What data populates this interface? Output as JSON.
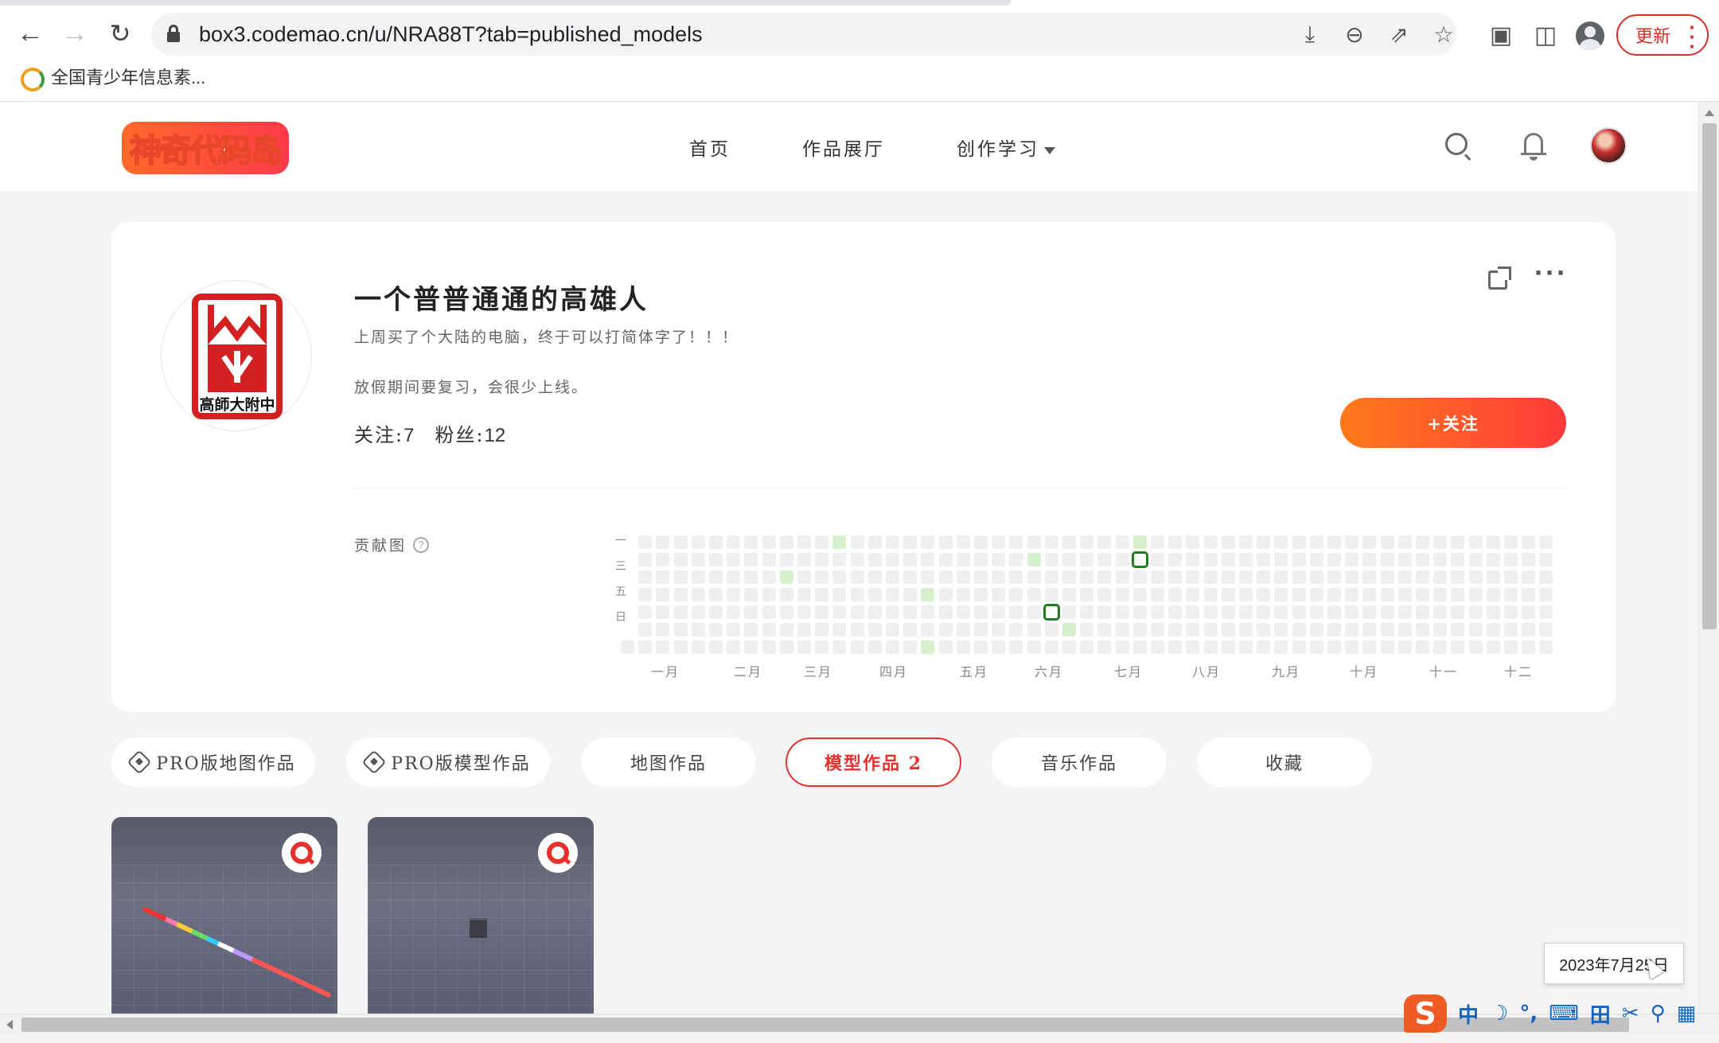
{
  "browser": {
    "url": "box3.codemao.cn/u/NRA88T?tab=published_models",
    "update_label": "更新",
    "bookmark": "全国青少年信息素..."
  },
  "site": {
    "logo_text": "神奇代码岛",
    "nav": [
      "首页",
      "作品展厅",
      "创作学习"
    ]
  },
  "profile": {
    "name": "一个普普通通的高雄人",
    "bio_line1": "上周买了个大陆的电脑，终于可以打简体字了！！！",
    "bio_line2": "放假期间要复习，会很少上线。",
    "following_label": "关注:",
    "following_count": "7",
    "followers_label": "粉丝:",
    "followers_count": "12",
    "follow_button": "+关注",
    "school_logo_text": "高師大附中"
  },
  "contribution": {
    "label": "贡献图",
    "day_labels": [
      "一",
      "三",
      "五",
      "日"
    ],
    "months": [
      "一月",
      "二月",
      "三月",
      "四月",
      "五月",
      "六月",
      "七月",
      "八月",
      "九月",
      "十月",
      "十一",
      "十二"
    ],
    "active_cells": [
      {
        "week": 12,
        "day": 0
      },
      {
        "week": 29,
        "day": 0
      },
      {
        "week": 23,
        "day": 1
      },
      {
        "week": 9,
        "day": 2
      },
      {
        "week": 17,
        "day": 3
      },
      {
        "week": 25,
        "day": 5
      },
      {
        "week": 17,
        "day": 6
      }
    ],
    "highlighted_cells": [
      {
        "week": 29,
        "day": 1
      },
      {
        "week": 24,
        "day": 4
      }
    ]
  },
  "tabs": [
    {
      "label": "PRO版地图作品",
      "icon": "pro-icon"
    },
    {
      "label": "PRO版模型作品",
      "icon": "pro-icon"
    },
    {
      "label": "地图作品"
    },
    {
      "label": "模型作品 2",
      "active": true
    },
    {
      "label": "音乐作品"
    },
    {
      "label": "收藏"
    }
  ],
  "tooltip": "2023年7月25日",
  "ime": [
    "中",
    "☽",
    "°,",
    "⌨",
    "田",
    "✂",
    "⚲",
    "▦"
  ],
  "colors": {
    "accent": "#e5322d",
    "follow_gradient_start": "#ff7a1a",
    "follow_gradient_end": "#ff3a3a",
    "contribution_active": "#d7f0cc",
    "contribution_highlight": "#1e7b1e"
  }
}
